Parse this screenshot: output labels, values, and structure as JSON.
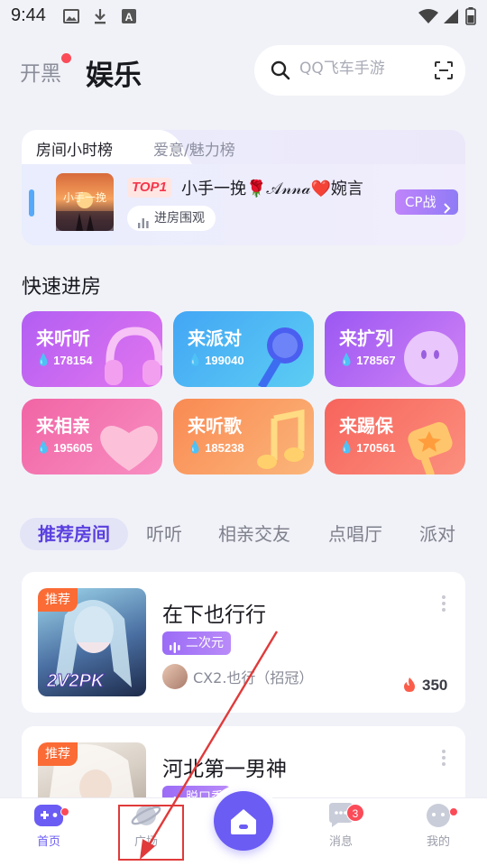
{
  "status_bar": {
    "time": "9:44"
  },
  "header": {
    "tab_kaihei": "开黑",
    "tab_yule": "娱乐"
  },
  "search": {
    "placeholder": "QQ飞车手游"
  },
  "ranking": {
    "tab_active": "房间小时榜",
    "tab_inactive": "爱意/魅力榜",
    "cover_text": "小手一挽",
    "badge": "TOP1",
    "room_name": "小手一挽🌹𝒜𝓃𝓃𝒶❤️婉言",
    "enter_label": "进房围观",
    "cp_label": "CP战"
  },
  "quick": {
    "title": "快速进房",
    "cards": [
      {
        "label": "来听听",
        "count": "178154"
      },
      {
        "label": "来派对",
        "count": "199040"
      },
      {
        "label": "来扩列",
        "count": "178567"
      },
      {
        "label": "来相亲",
        "count": "195605"
      },
      {
        "label": "来听歌",
        "count": "185238"
      },
      {
        "label": "来踢保",
        "count": "170561"
      }
    ]
  },
  "categories": [
    "推荐房间",
    "听听",
    "相亲交友",
    "点唱厅",
    "派对"
  ],
  "rooms": [
    {
      "tag": "推荐",
      "title": "在下也行行",
      "genre": "二次元",
      "host": "CX2.也行（招冠）",
      "heat": "350",
      "cover_overlay": "2V2PK"
    },
    {
      "tag": "推荐",
      "title": "河北第一男神",
      "genre": "脱口秀"
    }
  ],
  "nav": {
    "items": [
      "首页",
      "广场",
      "消息",
      "我的"
    ],
    "message_badge": "3"
  },
  "colors": {
    "accent": "#6b5cf4",
    "red": "#fb4b58",
    "highlight": "#e03a3a"
  }
}
